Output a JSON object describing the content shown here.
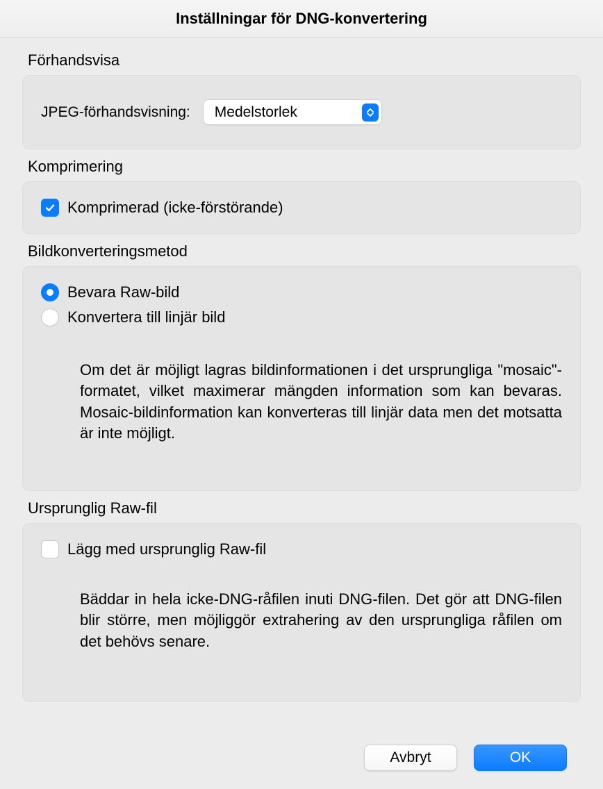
{
  "title": "Inställningar för DNG-konvertering",
  "preview": {
    "section_label": "Förhandsvisa",
    "field_label": "JPEG-förhandsvisning:",
    "selected": "Medelstorlek"
  },
  "compression": {
    "section_label": "Komprimering",
    "checkbox_label": "Komprimerad (icke-förstörande)",
    "checked": true
  },
  "conversion": {
    "section_label": "Bildkonverteringsmetod",
    "option_preserve": "Bevara Raw-bild",
    "option_linear": "Konvertera till linjär bild",
    "selected": "preserve",
    "description": "Om det är möjligt lagras bildinformationen i det ursprungliga \"mosaic\"-formatet, vilket maximerar mängden information som kan bevaras. Mosaic-bildinformation kan konverteras till linjär data men det motsatta är inte möjligt."
  },
  "original_raw": {
    "section_label": "Ursprunglig Raw-fil",
    "checkbox_label": "Lägg med ursprunglig Raw-fil",
    "checked": false,
    "description": "Bäddar in hela icke-DNG-råfilen inuti DNG-filen. Det gör att DNG-filen blir större, men möjliggör extrahering av den ursprungliga råfilen om det behövs senare."
  },
  "buttons": {
    "cancel": "Avbryt",
    "ok": "OK"
  }
}
